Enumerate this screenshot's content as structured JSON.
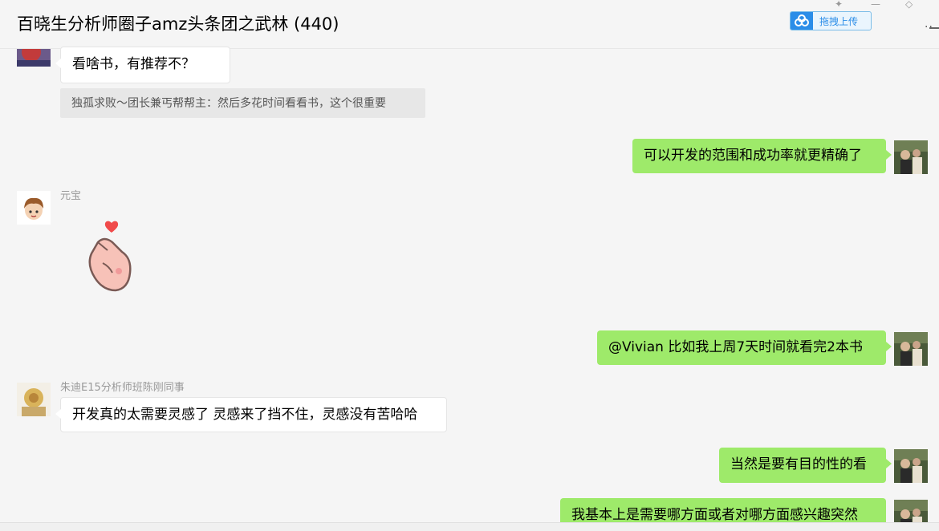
{
  "header": {
    "title": "百晓生分析师圈子amz头条团之武林 (440)",
    "upload_label": "拖拽上传"
  },
  "messages": [
    {
      "side": "left",
      "text": "看啥书，有推荐不？"
    },
    {
      "quote": "独孤求败～团长兼丐帮帮主：然后多花时间看看书，这个很重要"
    },
    {
      "side": "right",
      "text": "可以开发的范围和成功率就更精确了"
    },
    {
      "side": "left",
      "sender": "元宝",
      "sticker": "finger-heart-sticker"
    },
    {
      "side": "right",
      "text": "@Vivian 比如我上周7天时间就看完2本书"
    },
    {
      "side": "left",
      "sender": "朱迪E15分析师班陈刚同事",
      "text": "开发真的太需要灵感了 灵感来了挡不住，灵感没有苦哈哈"
    },
    {
      "side": "right",
      "text": "当然是要有目的性的看"
    },
    {
      "side": "right",
      "text": "我基本上是需要哪方面或者对哪方面感兴趣突然"
    }
  ],
  "colors": {
    "self_bubble": "#9eea6a",
    "other_bubble": "#ffffff",
    "background": "#f5f5f5",
    "upload_accent": "#2b8de8"
  }
}
